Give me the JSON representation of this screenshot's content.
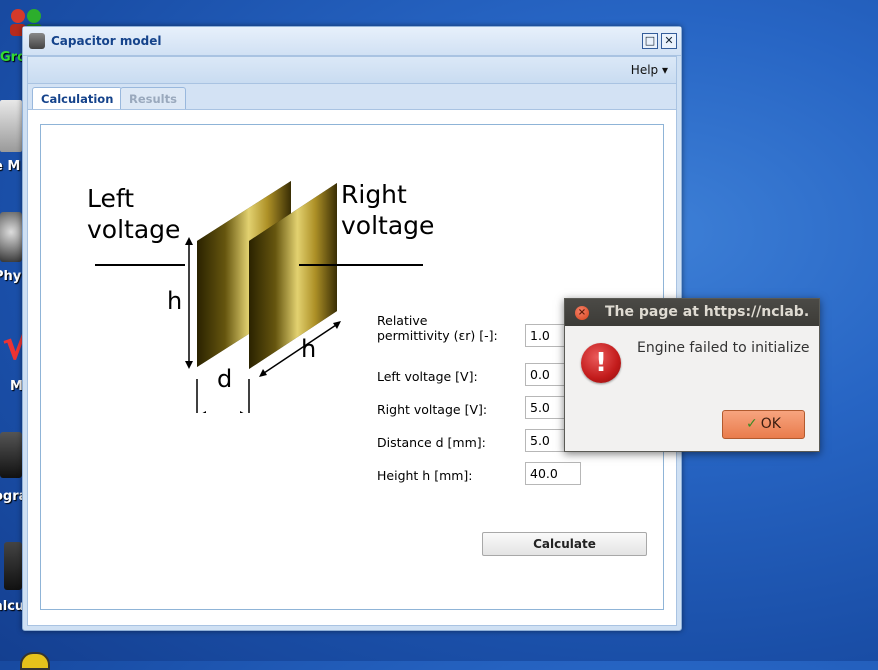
{
  "desktop": {
    "icons": [
      {
        "label": "Gro"
      },
      {
        "label": "e M"
      },
      {
        "label": "Phy"
      },
      {
        "label": "M"
      },
      {
        "label": "ogra"
      },
      {
        "label": "alcu"
      }
    ]
  },
  "window": {
    "title": "Capacitor model",
    "help_menu": "Help ▾",
    "maximize_glyph": "□",
    "close_glyph": "✕"
  },
  "tabs": [
    {
      "label": "Calculation",
      "active": true
    },
    {
      "label": "Results",
      "active": false
    }
  ],
  "diagram": {
    "left_label_line1": "Left",
    "left_label_line2": "voltage",
    "right_label_line1": "Right",
    "right_label_line2": "voltage",
    "height_label": "h",
    "height_label_2": "h",
    "distance_label": "d"
  },
  "form": {
    "fields": [
      {
        "label_line1": "Relative",
        "label_line2": "permittivity (εr) [-]:",
        "value": "1.0"
      },
      {
        "label": "Left voltage [V]:",
        "value": "0.0"
      },
      {
        "label": "Right voltage [V]:",
        "value": "5.0"
      },
      {
        "label": "Distance d [mm]:",
        "value": "5.0"
      },
      {
        "label": "Height h [mm]:",
        "value": "40.0"
      }
    ],
    "calculate_label": "Calculate"
  },
  "dialog": {
    "title": "The page at https://nclab.",
    "message": "Engine failed to initialize",
    "icon_glyph": "!",
    "ok_label": "OK",
    "close_glyph": "×"
  }
}
